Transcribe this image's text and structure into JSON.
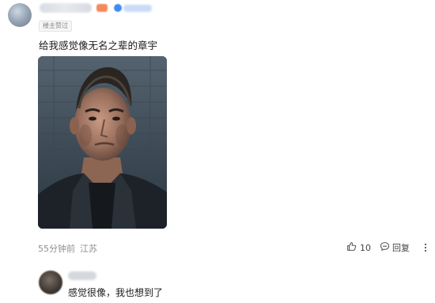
{
  "comment": {
    "owner_badge": "楼主赞过",
    "text": "给我感觉像无名之辈的章宇",
    "time": "55分钟前",
    "location": "江苏",
    "like_count": "10",
    "reply_label": "回复"
  },
  "reply": {
    "text": "感觉很像，我也想到了"
  },
  "icons": {
    "like": "thumbs-up-icon",
    "reply": "chat-bubble-icon",
    "more": "more-dots-icon",
    "verified": "verified-badge-icon"
  },
  "colors": {
    "level_badge": "#f28a5c",
    "verified": "#3d8bf2",
    "meta_text": "#8f8f8f"
  }
}
